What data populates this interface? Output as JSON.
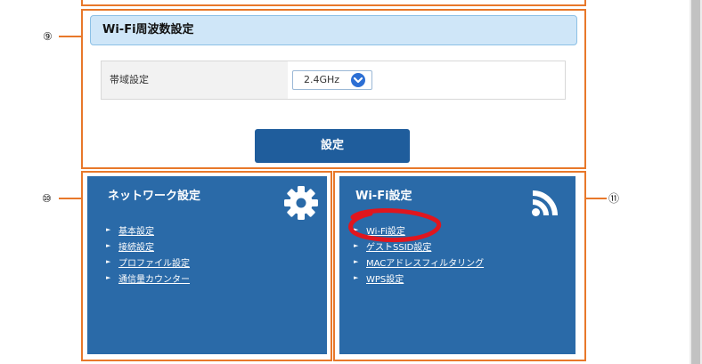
{
  "wifi_freq": {
    "header": "Wi-Fi周波数設定",
    "band_label": "帯域設定",
    "band_value": "2.4GHz",
    "apply_button": "設定"
  },
  "network_panel": {
    "title": "ネットワーク設定",
    "links": [
      "基本設定",
      "接続設定",
      "プロファイル設定",
      "通信量カウンター"
    ]
  },
  "wifi_panel": {
    "title": "Wi-Fi設定",
    "links": [
      "Wi-Fi設定",
      "ゲストSSID設定",
      "MACアドレスフィルタリング",
      "WPS設定"
    ]
  },
  "callouts": {
    "c9": "⑨",
    "c10": "⑩",
    "c11": "⑪"
  },
  "colors": {
    "accent_orange": "#e8782a",
    "panel_blue": "#2a6aa8",
    "button_blue": "#1f5d9c",
    "header_bg": "#cfe6f8",
    "highlight_red": "#e0161e"
  }
}
